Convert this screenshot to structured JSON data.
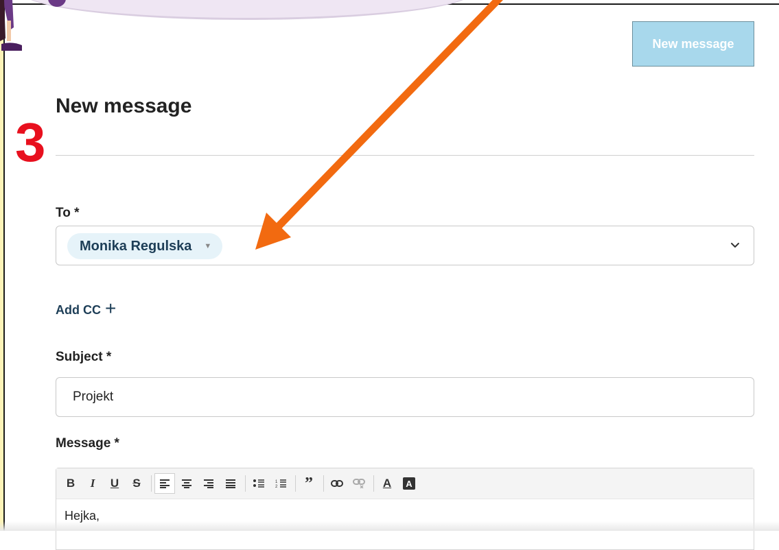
{
  "tutorial": {
    "step_number": "3"
  },
  "header": {
    "new_message_button": "New message"
  },
  "form": {
    "title": "New message",
    "to": {
      "label": "To *",
      "recipients": [
        "Monika Regulska"
      ]
    },
    "add_cc_label": "Add CC",
    "add_cc_icon": "+",
    "subject": {
      "label": "Subject *",
      "value": "Projekt"
    },
    "message": {
      "label": "Message *",
      "body": "Hejka,"
    }
  },
  "toolbar": {
    "bold": "B",
    "italic": "I",
    "underline": "U",
    "strikethrough": "S",
    "active_tool": "align-left",
    "text_color": "A",
    "background_color": "A"
  },
  "colors": {
    "step_number": "#e8101e",
    "arrow": "#f26a10",
    "button_bg": "#a8d8ec",
    "chip_bg": "#e6f3f9",
    "link": "#1d3e57"
  }
}
